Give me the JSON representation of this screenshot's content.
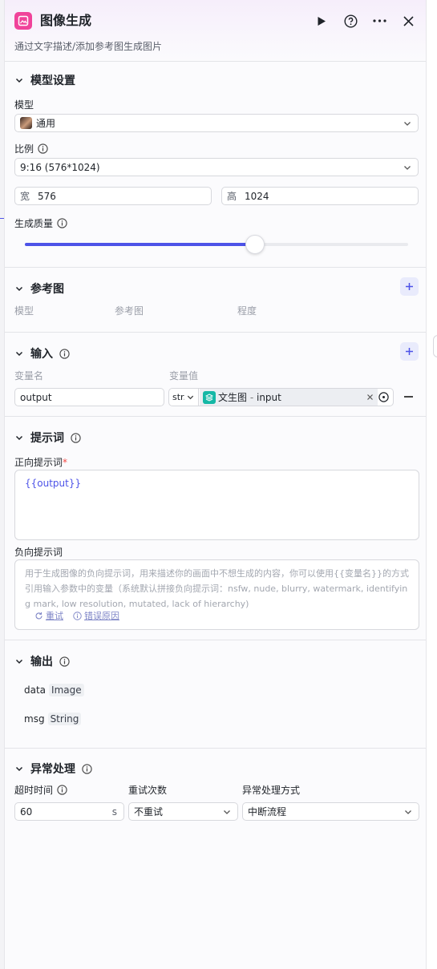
{
  "header": {
    "title": "图像生成",
    "subtitle": "通过文字描述/添加参考图生成图片"
  },
  "model_settings": {
    "section_title": "模型设置",
    "model_label": "模型",
    "model_value": "通用",
    "ratio_label": "比例",
    "ratio_value": "9:16 (576*1024)",
    "width_prefix": "宽",
    "width_value": "576",
    "height_prefix": "高",
    "height_value": "1024",
    "quality_label": "生成质量",
    "quality_fraction": 0.6
  },
  "reference": {
    "section_title": "参考图",
    "columns": [
      "模型",
      "参考图",
      "程度"
    ]
  },
  "input": {
    "section_title": "输入",
    "col_name": "变量名",
    "col_value": "变量值",
    "var_name": "output",
    "type_abbr": "str.",
    "ref_node": "文生图",
    "ref_sep": " - ",
    "ref_field": "input"
  },
  "prompt": {
    "section_title": "提示词",
    "positive_label": "正向提示词",
    "required_mark": "*",
    "positive_value": "{{output}}",
    "negative_label": "负向提示词",
    "negative_placeholder": "用于生成图像的负向提示词，用来描述你的画面中不想生成的内容，你可以使用{{变量名}}的方式引用输入参数中的变量（系统默认拼接负向提示词：nsfw, nude, blurry, watermark, identifying mark, low resolution, mutated, lack of hierarchy)",
    "retry": "重试",
    "error_reason": "错误原因"
  },
  "output": {
    "section_title": "输出",
    "fields": [
      {
        "name": "data",
        "type": "Image"
      },
      {
        "name": "msg",
        "type": "String"
      }
    ]
  },
  "exception": {
    "section_title": "异常处理",
    "timeout_label": "超时时间",
    "timeout_value": "60",
    "timeout_unit": "s",
    "retry_label": "重试次数",
    "retry_value": "不重试",
    "mode_label": "异常处理方式",
    "mode_value": "中断流程"
  },
  "colors": {
    "accent": "#4d53e8",
    "node_icon": "#f0439a",
    "ref_chip": "#15b8a6"
  }
}
